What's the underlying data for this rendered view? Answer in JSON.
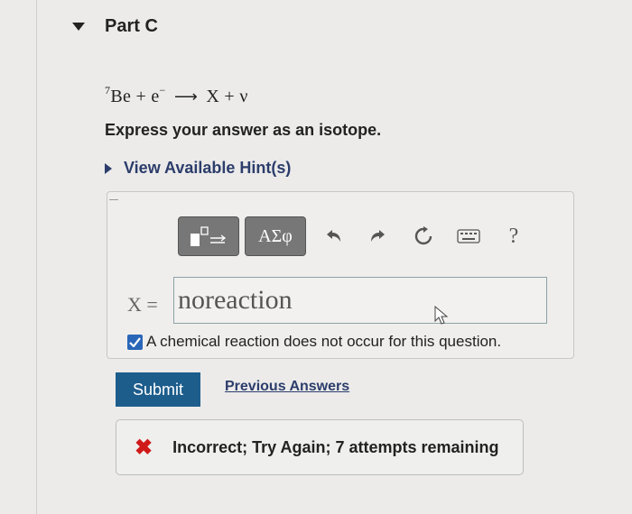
{
  "part": {
    "title": "Part C"
  },
  "equation": {
    "mass_number": "7",
    "reactant_1": "Be",
    "plus_1": "+",
    "reactant_2": "e",
    "reactant_2_charge": "−",
    "arrow": "⟶",
    "product_1": "X",
    "plus_2": "+",
    "product_2": "ν"
  },
  "instruction": "Express your answer as an isotope.",
  "hints": {
    "label": "View Available Hint(s)"
  },
  "toolbar": {
    "templates_icon": "templates-icon",
    "symbols_label": "ΑΣφ",
    "undo_icon": "undo-icon",
    "redo_icon": "redo-icon",
    "reset_icon": "reset-icon",
    "keyboard_icon": "keyboard-icon",
    "help_label": "?"
  },
  "answer": {
    "variable_label": "X =",
    "value": "noreaction",
    "checkbox_checked": true,
    "checkbox_label": "A chemical reaction does not occur for this question."
  },
  "actions": {
    "submit_label": "Submit",
    "previous_answers_label": "Previous Answers"
  },
  "feedback": {
    "status": "incorrect",
    "message": "Incorrect; Try Again; 7 attempts remaining",
    "color": "#d01a1a"
  }
}
